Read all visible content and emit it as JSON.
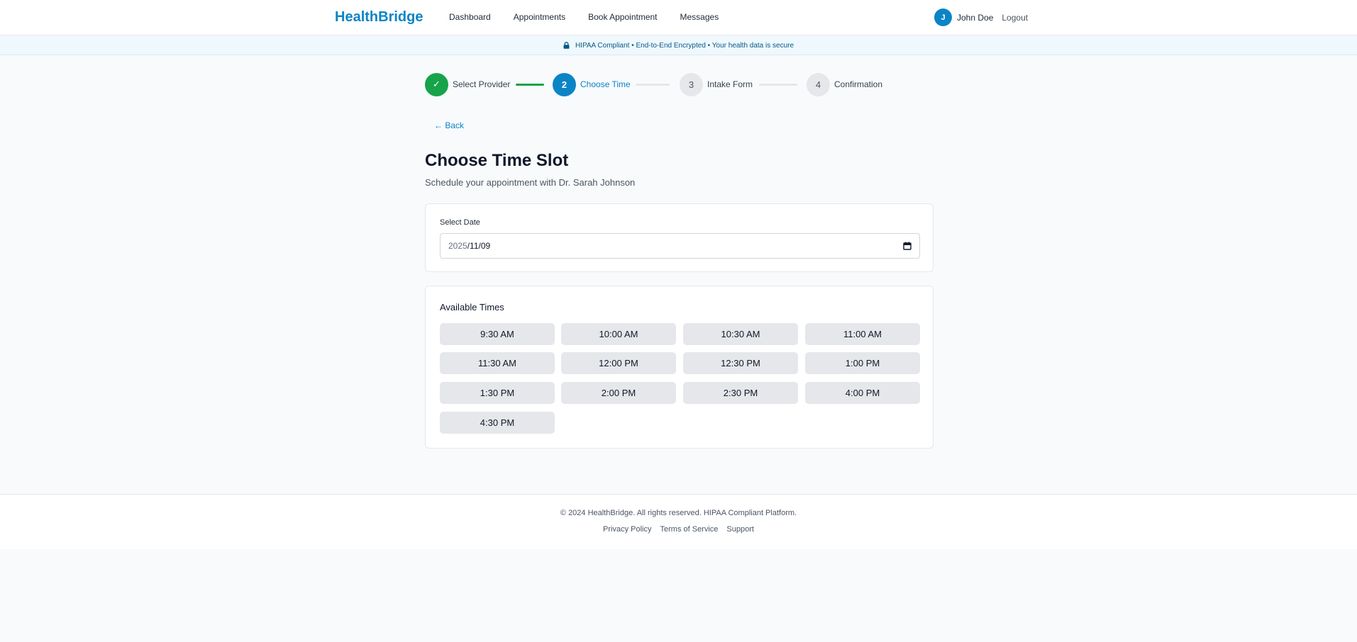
{
  "header": {
    "brand": "HealthBridge",
    "nav": [
      "Dashboard",
      "Appointments",
      "Book Appointment",
      "Messages"
    ],
    "user": {
      "initial": "J",
      "name": "John Doe",
      "logout": "Logout"
    }
  },
  "banner": {
    "text": "HIPAA Compliant • End-to-End Encrypted • Your health data is secure",
    "icon": "lock-icon"
  },
  "stepper": {
    "steps": [
      {
        "number": "✓",
        "label": "Select Provider",
        "status": "completed"
      },
      {
        "number": "2",
        "label": "Choose Time",
        "status": "active"
      },
      {
        "number": "3",
        "label": "Intake Form",
        "status": "pending"
      },
      {
        "number": "4",
        "label": "Confirmation",
        "status": "pending"
      }
    ]
  },
  "back": "← Back",
  "page": {
    "title": "Choose Time Slot",
    "subtitle": "Schedule your appointment with Dr. Sarah Johnson"
  },
  "date_field": {
    "label": "Select Date",
    "value_year": "2025",
    "value_rest": "/11/09"
  },
  "times": {
    "heading": "Available Times",
    "slots": [
      "9:30 AM",
      "10:00 AM",
      "10:30 AM",
      "11:00 AM",
      "11:30 AM",
      "12:00 PM",
      "12:30 PM",
      "1:00 PM",
      "1:30 PM",
      "2:00 PM",
      "2:30 PM",
      "4:00 PM",
      "4:30 PM"
    ]
  },
  "footer": {
    "copyright": "© 2024 HealthBridge. All rights reserved. HIPAA Compliant Platform.",
    "links": [
      "Privacy Policy",
      "Terms of Service",
      "Support"
    ]
  },
  "colors": {
    "brand": "#0b84c6",
    "success": "#16a34a",
    "slot_bg": "#e5e7eb",
    "banner_bg": "#eff8fd"
  }
}
